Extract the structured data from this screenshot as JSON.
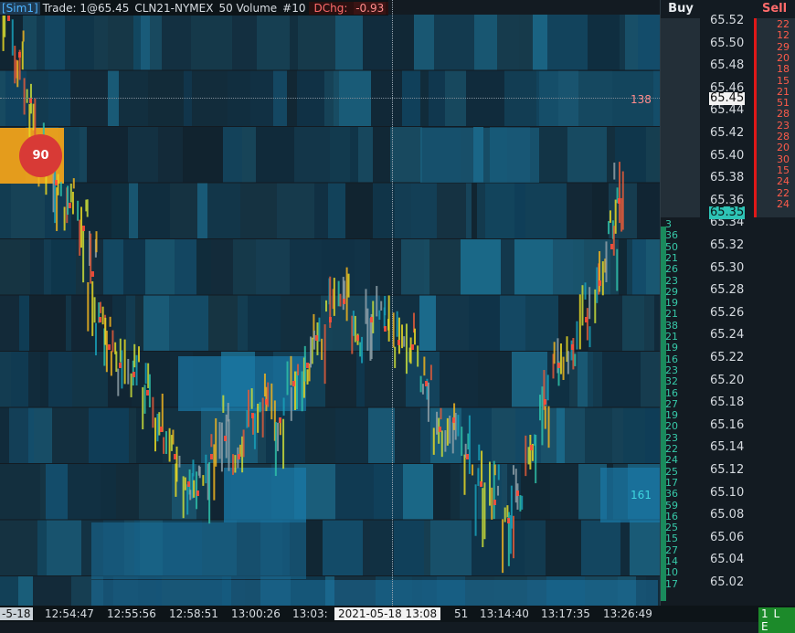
{
  "header": {
    "account": "[Sim1]",
    "trade": "Trade: 1@65.45",
    "instrument": "CLN21-NYMEX",
    "bar_type": "50 Volume",
    "bar_count": "#10",
    "dchg_label": "DChg:",
    "dchg_value": "-0.93"
  },
  "ladder": {
    "buy_header": "Buy",
    "sell_header": "Sell",
    "prices": [
      "65.52",
      "65.50",
      "65.48",
      "65.46",
      "65.44",
      "65.42",
      "65.40",
      "65.38",
      "65.36",
      "65.34",
      "65.32",
      "65.30",
      "65.28",
      "65.26",
      "65.24",
      "65.22",
      "65.20",
      "65.18",
      "65.16",
      "65.14",
      "65.12",
      "65.10",
      "65.08",
      "65.06",
      "65.04",
      "65.02"
    ],
    "last_price": "65.45",
    "ask_price": "65.35",
    "sell_sizes": [
      "22",
      "12",
      "29",
      "20",
      "18",
      "15",
      "21",
      "51",
      "28",
      "23",
      "28",
      "20",
      "30",
      "15",
      "24",
      "22",
      "24"
    ],
    "buy_sizes": [
      "3",
      "36",
      "50",
      "21",
      "26",
      "23",
      "29",
      "19",
      "21",
      "38",
      "21",
      "19",
      "16",
      "23",
      "32",
      "16",
      "27",
      "19",
      "20",
      "23",
      "22",
      "24",
      "25",
      "17",
      "36",
      "59",
      "16",
      "25",
      "15",
      "27",
      "14",
      "10",
      "17"
    ]
  },
  "chart_labels": {
    "bubble_volume": "90",
    "vol_label_upper": "138",
    "vol_label_lower": "161"
  },
  "time_axis": {
    "left_stub": "-5-18",
    "labels": [
      "12:54:47",
      "12:55:56",
      "12:58:51",
      "13:00:26",
      "13:03:",
      "51",
      "13:14:40",
      "13:17:35",
      "13:26:49"
    ],
    "cursor_date": "2021-05-18  13:08",
    "status": "1 L E"
  },
  "colors": {
    "background": "#131b22",
    "buy_accent": "#37c8a8",
    "sell_accent": "#ff5b4a",
    "ask_highlight": "#2ec4b6",
    "bubble": "#d83a36"
  }
}
